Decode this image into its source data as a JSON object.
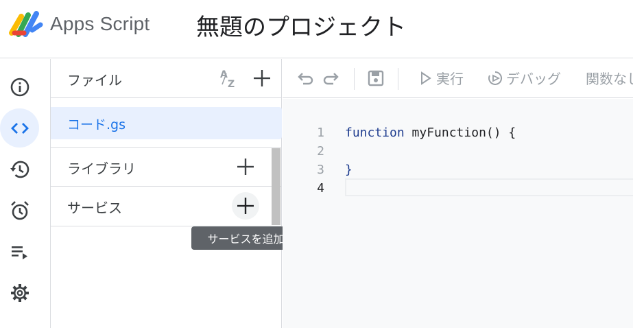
{
  "header": {
    "app_name": "Apps Script",
    "project_title": "無題のプロジェクト"
  },
  "rail": {
    "items": [
      {
        "icon": "info-icon",
        "active": false
      },
      {
        "icon": "code-icon",
        "active": true
      },
      {
        "icon": "history-icon",
        "active": false
      },
      {
        "icon": "alarm-icon",
        "active": false
      },
      {
        "icon": "playlist-icon",
        "active": false
      },
      {
        "icon": "gear-icon",
        "active": false
      }
    ]
  },
  "panel": {
    "files_label": "ファイル",
    "files": [
      {
        "name": "コード.gs"
      }
    ],
    "libraries_label": "ライブラリ",
    "services_label": "サービス",
    "tooltip": "サービスを追加"
  },
  "toolbar": {
    "run_label": "実行",
    "debug_label": "デバッグ",
    "function_select": "関数なし"
  },
  "editor": {
    "lines": [
      {
        "num": "1",
        "keyword": "function",
        "rest": " myFunction() {"
      },
      {
        "num": "2",
        "keyword": "",
        "rest": ""
      },
      {
        "num": "3",
        "keyword": "}",
        "rest": ""
      },
      {
        "num": "4",
        "keyword": "",
        "rest": ""
      }
    ]
  },
  "colors": {
    "accent": "#1a73e8",
    "active_bg": "#e8f0fe",
    "keyword": "#1f3d8f"
  }
}
